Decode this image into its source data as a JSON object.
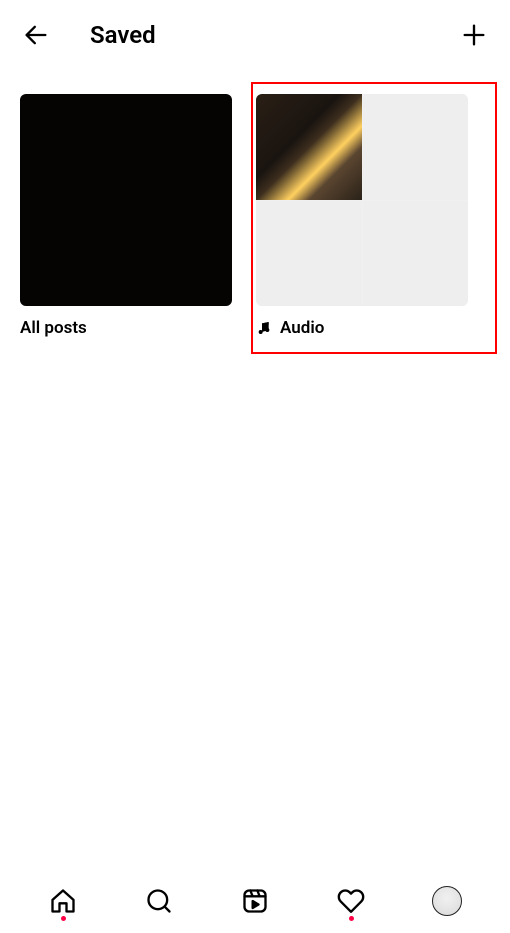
{
  "header": {
    "title": "Saved"
  },
  "collections": {
    "all_posts": {
      "label": "All posts"
    },
    "audio": {
      "label": "Audio"
    }
  },
  "icons": {
    "back": "back-arrow",
    "plus": "plus",
    "music": "music-note",
    "home": "home",
    "search": "search",
    "reels": "reels",
    "activity": "heart",
    "profile": "profile"
  }
}
